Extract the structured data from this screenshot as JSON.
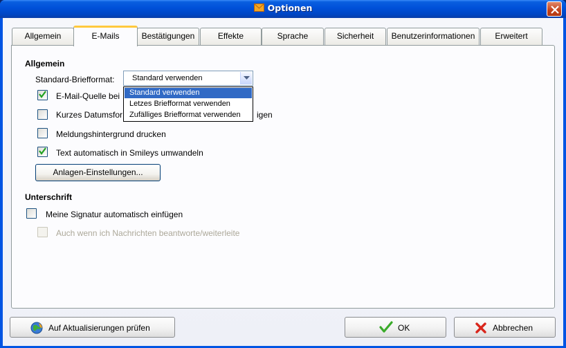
{
  "window": {
    "title": "Optionen",
    "icon": "envelope-icon"
  },
  "tabs": [
    {
      "label": "Allgemein"
    },
    {
      "label": "E-Mails",
      "active": true
    },
    {
      "label": "Bestätigungen"
    },
    {
      "label": "Effekte"
    },
    {
      "label": "Sprache"
    },
    {
      "label": "Sicherheit"
    },
    {
      "label": "Benutzerinformationen"
    },
    {
      "label": "Erweitert"
    }
  ],
  "general": {
    "heading": "Allgemein",
    "format_label": "Standard-Briefformat:",
    "format_value": "Standard verwenden",
    "format_options": [
      "Standard verwenden",
      "Letzes Briefformat verwenden",
      "Zufälliges Briefformat verwenden"
    ],
    "checkboxes": [
      {
        "label": "E-Mail-Quelle bei",
        "checked": true
      },
      {
        "label": "Kurzes Datumsfor",
        "label_tail": "igen",
        "checked": false
      },
      {
        "label": "Meldungshintergrund drucken",
        "checked": false
      },
      {
        "label": "Text automatisch in Smileys umwandeln",
        "checked": true
      }
    ],
    "attachments_button": "Anlagen-Einstellungen..."
  },
  "signature": {
    "heading": "Unterschrift",
    "auto_insert": {
      "label": "Meine Signatur automatisch einfügen",
      "checked": false
    },
    "on_reply": {
      "label": "Auch wenn ich Nachrichten beantworte/weiterleite",
      "checked": false,
      "disabled": true
    }
  },
  "footer": {
    "update_button": "Auf Aktualisierungen prüfen",
    "ok_button": "OK",
    "cancel_button": "Abbrechen"
  }
}
